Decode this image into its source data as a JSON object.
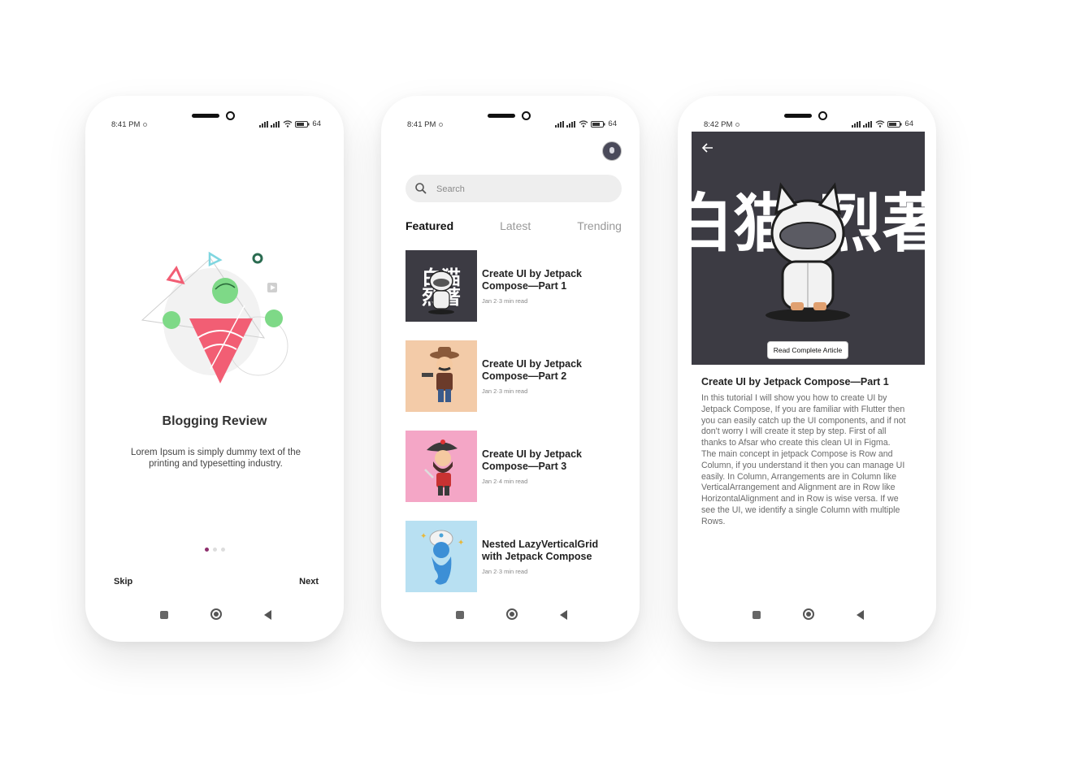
{
  "colors": {
    "accent": "#8e2f6d",
    "hero_bg": "#3c3b43",
    "search_bg": "#eeeeee"
  },
  "status_bars": [
    {
      "time": "8:41 PM",
      "battery": "64"
    },
    {
      "time": "8:41 PM",
      "battery": "64"
    },
    {
      "time": "8:42 PM",
      "battery": "64"
    }
  ],
  "onboarding": {
    "title": "Blogging Review",
    "description": "Lorem Ipsum is simply dummy text of the printing and typesetting industry.",
    "skip_label": "Skip",
    "next_label": "Next",
    "page_count": 3,
    "active_page": 1
  },
  "home": {
    "search_placeholder": "Search",
    "tabs": [
      {
        "label": "Featured",
        "active": true
      },
      {
        "label": "Latest",
        "active": false
      },
      {
        "label": "Trending",
        "active": false
      }
    ],
    "articles": [
      {
        "title": "Create UI by Jetpack Compose—Part 1",
        "meta": "Jan 2·3 min read",
        "thumb": "cat-robot-thumbnail"
      },
      {
        "title": "Create UI by Jetpack Compose—Part 2",
        "meta": "Jan 2·3 min read",
        "thumb": "cowboy-thumbnail"
      },
      {
        "title": "Create UI by Jetpack Compose—Part 3",
        "meta": "Jan 2·4 min read",
        "thumb": "pirate-thumbnail"
      },
      {
        "title": "Nested LazyVerticalGrid with Jetpack Compose",
        "meta": "Jan 2·3 min read",
        "thumb": "genie-thumbnail"
      }
    ]
  },
  "detail": {
    "hero_text": "白猫 烈著",
    "read_button_label": "Read Complete Article",
    "title": "Create UI by Jetpack Compose—Part 1",
    "body": "In this tutorial I will show you how to create UI by Jetpack Compose, If you are familiar with Flutter then you can easily catch up the UI components, and if not don't worry I will create it step by step. First of all thanks to Afsar who create this clean UI in Figma.\nThe main concept in jetpack Compose is Row and Column, if you understand it then you can manage UI easily. In Column, Arrangements are in Column like VerticalArrangement and Alignment are in Row like HorizontalAlignment and in Row is wise versa. If we see the UI, we identify a single Column with multiple Rows."
  }
}
